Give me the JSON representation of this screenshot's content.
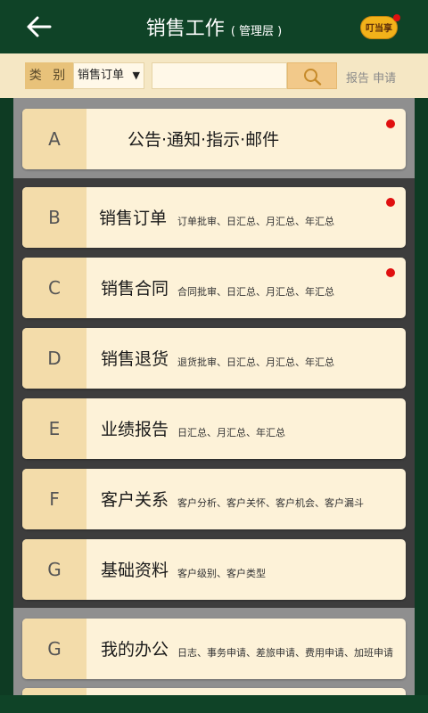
{
  "header": {
    "title": "销售工作",
    "subtitle": "( 管理层 )",
    "logo_text": "叮当享"
  },
  "filter": {
    "category_label": "类 别",
    "category_value": "销售订单",
    "search_value": "",
    "report_link": "报告 申请"
  },
  "colors": {
    "header_bg": "#0f4327",
    "filter_bg": "#f5e7c4",
    "card_bg": "#fdf2d8",
    "letter_bg": "#f3dcaa",
    "notify_dot": "#e01010"
  },
  "cards": [
    {
      "letter": "A",
      "name": "公告·通知·指示·邮件",
      "desc": "",
      "badge": true
    },
    {
      "letter": "B",
      "name": "销售订单",
      "desc": "订单批审、日汇总、月汇总、年汇总",
      "badge": true
    },
    {
      "letter": "C",
      "name": "销售合同",
      "desc": "合同批审、日汇总、月汇总、年汇总",
      "badge": true
    },
    {
      "letter": "D",
      "name": "销售退货",
      "desc": "退货批审、日汇总、月汇总、年汇总",
      "badge": false
    },
    {
      "letter": "E",
      "name": "业绩报告",
      "desc": "日汇总、月汇总、年汇总",
      "badge": false
    },
    {
      "letter": "F",
      "name": "客户关系",
      "desc": "客户分析、客户关怀、客户机会、客户漏斗",
      "badge": false
    },
    {
      "letter": "G",
      "name": "基础资料",
      "desc": "客户级别、客户类型",
      "badge": false
    },
    {
      "letter": "G",
      "name": "我的办公",
      "desc": "日志、事务申请、差旅申请、费用申请、加班申请",
      "badge": false
    }
  ]
}
